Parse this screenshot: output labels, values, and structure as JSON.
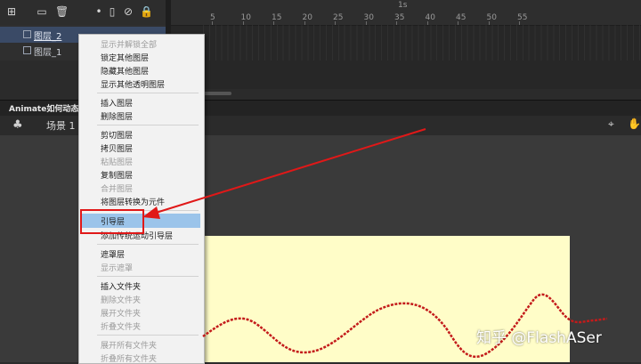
{
  "timeline": {
    "layers": [
      {
        "name": "图层_2",
        "selected": true
      },
      {
        "name": "图层_1",
        "selected": false
      }
    ],
    "ruler": {
      "second_label": "1s",
      "ticks": [
        "5",
        "10",
        "15",
        "20",
        "25",
        "30",
        "35",
        "40",
        "45",
        "50",
        "55"
      ]
    }
  },
  "stage": {
    "title": "Animate如何动态绘",
    "scene_label": "场景 1"
  },
  "context_menu": {
    "items": [
      {
        "label": "显示并解锁全部",
        "disabled": true
      },
      {
        "label": "锁定其他图层",
        "disabled": false
      },
      {
        "label": "隐藏其他图层",
        "disabled": false
      },
      {
        "label": "显示其他透明图层",
        "disabled": false
      },
      {
        "label": "插入图层",
        "disabled": false
      },
      {
        "label": "删除图层",
        "disabled": false
      },
      {
        "label": "剪切图层",
        "disabled": false
      },
      {
        "label": "拷贝图层",
        "disabled": false
      },
      {
        "label": "粘贴图层",
        "disabled": true
      },
      {
        "label": "复制图层",
        "disabled": false
      },
      {
        "label": "合并图层",
        "disabled": true
      },
      {
        "label": "将图层转换为元件",
        "disabled": false
      },
      {
        "label": "引导层",
        "disabled": false,
        "highlighted": true
      },
      {
        "label": "添加传统运动引导层",
        "disabled": false
      },
      {
        "label": "遮罩层",
        "disabled": false
      },
      {
        "label": "显示遮罩",
        "disabled": true
      },
      {
        "label": "插入文件夹",
        "disabled": false
      },
      {
        "label": "删除文件夹",
        "disabled": true
      },
      {
        "label": "展开文件夹",
        "disabled": true
      },
      {
        "label": "折叠文件夹",
        "disabled": true
      },
      {
        "label": "展开所有文件夹",
        "disabled": true
      },
      {
        "label": "折叠所有文件夹",
        "disabled": true
      }
    ]
  },
  "watermark": "知乎 @FlashASer",
  "colors": {
    "highlight": "#9bc4ea",
    "annotation_red": "#e01818",
    "stage_bg": "#fffdc8"
  }
}
